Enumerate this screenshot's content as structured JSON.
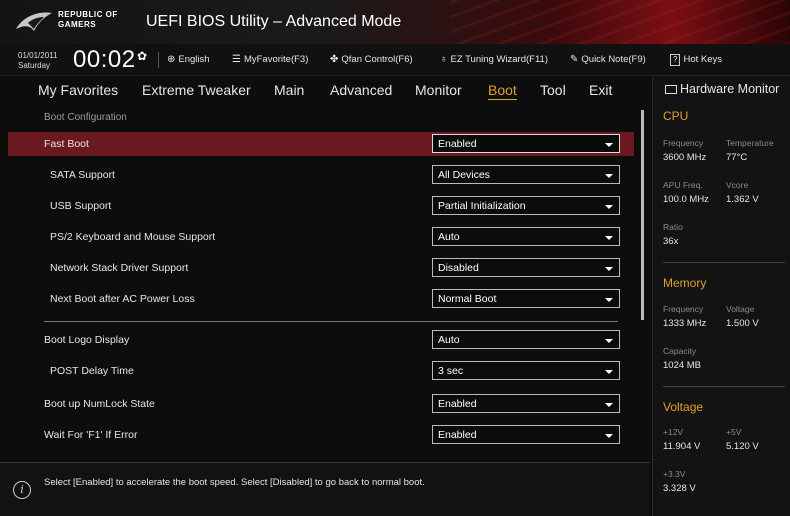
{
  "window": {
    "brand_line1": "REPUBLIC OF",
    "brand_line2": "GAMERS",
    "title": "UEFI BIOS Utility – Advanced Mode"
  },
  "infobar": {
    "date": "01/01/2011",
    "day": "Saturday",
    "time": "00:02",
    "items": {
      "language": "English",
      "myfavorite": "MyFavorite(F3)",
      "qfan": "Qfan Control(F6)",
      "ez_tuning": "EZ Tuning Wizard(F11)",
      "quick_note": "Quick Note(F9)",
      "hot_keys": "Hot Keys"
    }
  },
  "nav": {
    "tabs": [
      "My Favorites",
      "Extreme Tweaker",
      "Main",
      "Advanced",
      "Monitor",
      "Boot",
      "Tool",
      "Exit"
    ],
    "active": "Boot"
  },
  "main": {
    "section": "Boot Configuration",
    "rows": [
      {
        "label": "Fast Boot",
        "value": "Enabled"
      },
      {
        "label": "SATA Support",
        "value": "All Devices"
      },
      {
        "label": "USB Support",
        "value": "Partial Initialization"
      },
      {
        "label": "PS/2 Keyboard and Mouse Support",
        "value": "Auto"
      },
      {
        "label": "Network Stack Driver Support",
        "value": "Disabled"
      },
      {
        "label": "Next Boot after AC Power Loss",
        "value": "Normal Boot"
      },
      {
        "label": "Boot Logo Display",
        "value": "Auto"
      },
      {
        "label": "POST Delay Time",
        "value": "3 sec"
      },
      {
        "label": "Boot up NumLock State",
        "value": "Enabled"
      },
      {
        "label": "Wait For 'F1' If Error",
        "value": "Enabled"
      }
    ]
  },
  "help": {
    "text": "Select [Enabled] to accelerate the boot speed. Select [Disabled] to go back to normal boot."
  },
  "hardware_monitor": {
    "title": "Hardware Monitor",
    "cpu": {
      "heading": "CPU",
      "frequency_label": "Frequency",
      "frequency": "3600 MHz",
      "temperature_label": "Temperature",
      "temperature": "77°C",
      "apu_label": "APU Freq.",
      "apu": "100.0 MHz",
      "vcore_label": "Vcore",
      "vcore": "1.362 V",
      "ratio_label": "Ratio",
      "ratio": "36x"
    },
    "memory": {
      "heading": "Memory",
      "frequency_label": "Frequency",
      "frequency": "1333 MHz",
      "voltage_label": "Voltage",
      "voltage": "1.500 V",
      "capacity_label": "Capacity",
      "capacity": "1024 MB"
    },
    "voltage": {
      "heading": "Voltage",
      "v12_label": "+12V",
      "v12": "11.904 V",
      "v5_label": "+5V",
      "v5": "5.120 V",
      "v33_label": "+3.3V",
      "v33": "3.328 V"
    }
  },
  "colors": {
    "accent": "#e0a030",
    "selected_row": "#6a1a1e"
  }
}
